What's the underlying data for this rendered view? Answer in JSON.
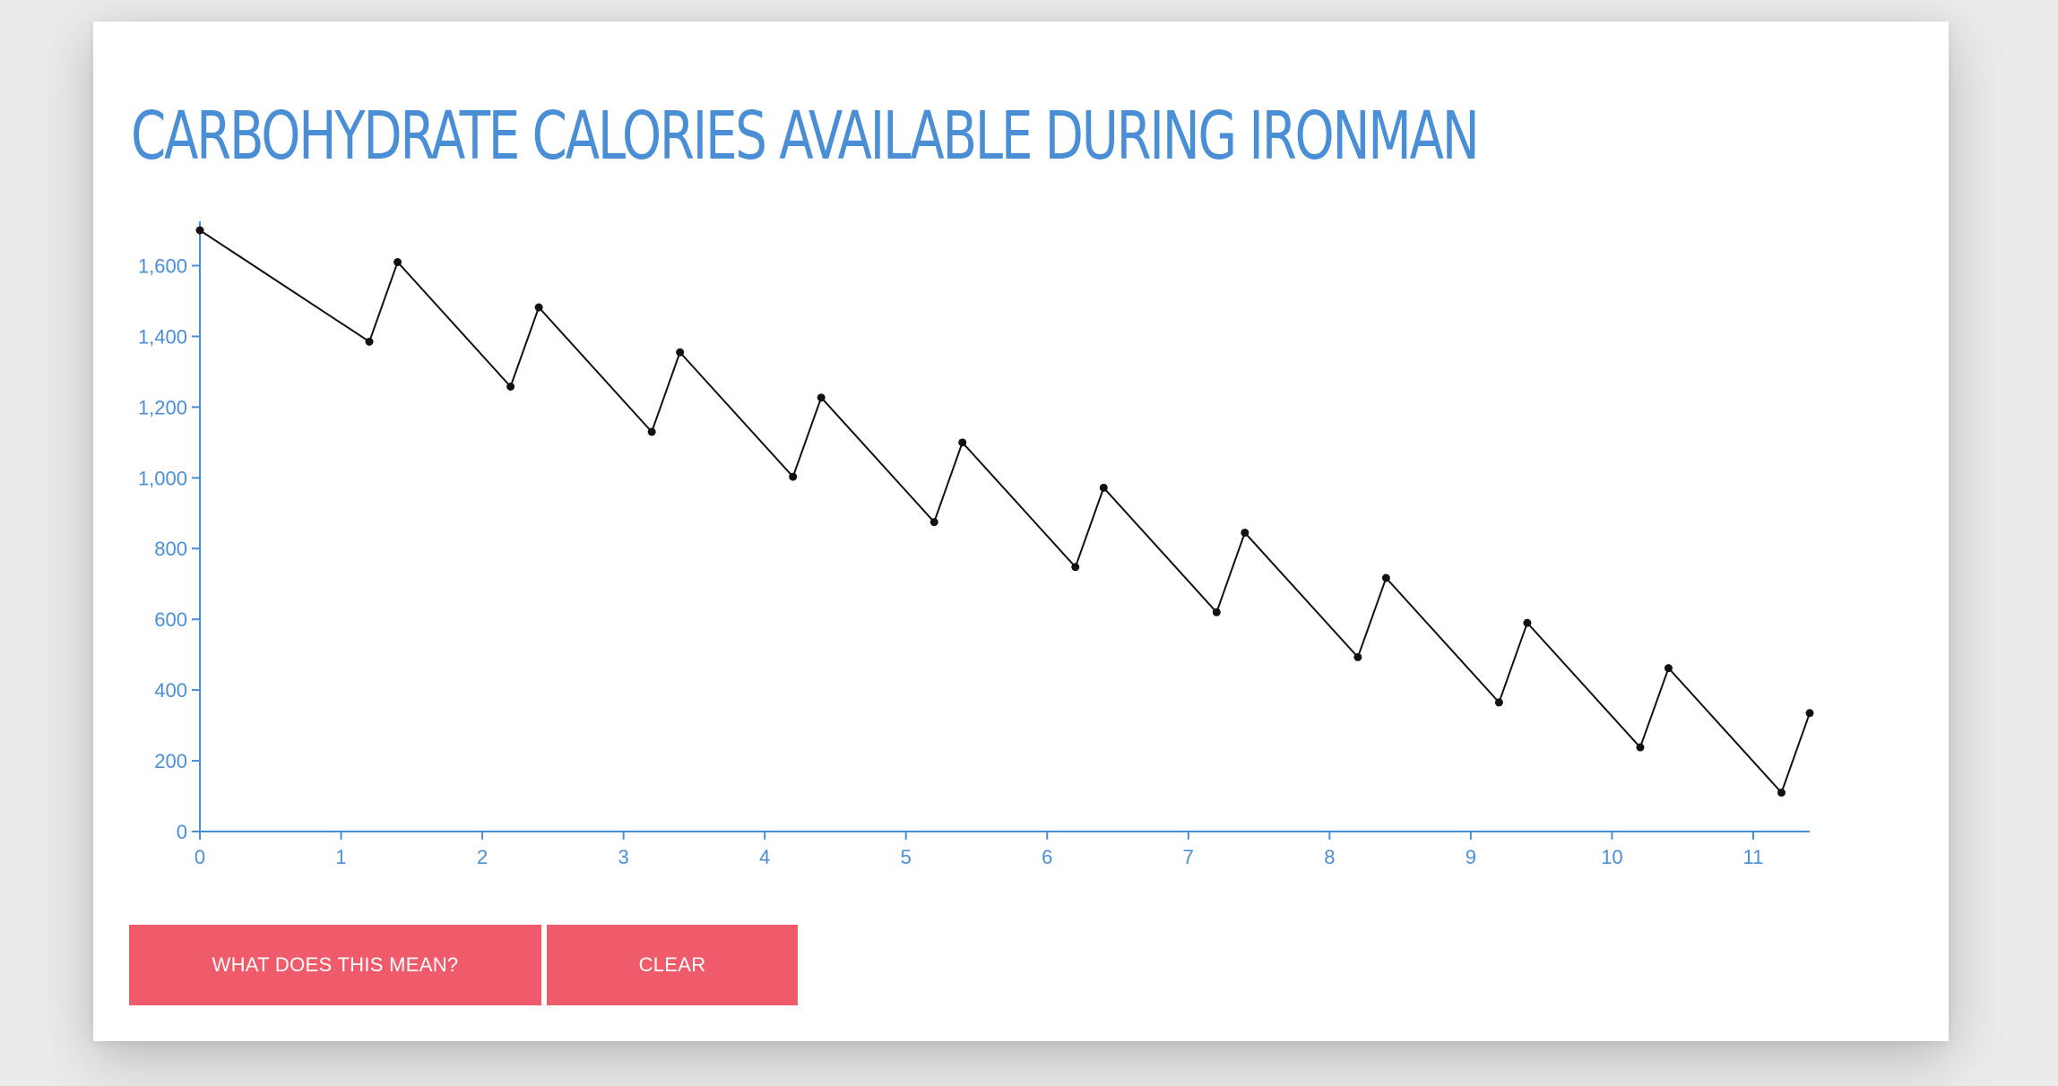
{
  "page": {
    "title": "CARBOHYDRATE CALORIES AVAILABLE DURING IRONMAN"
  },
  "buttons": {
    "meaning_label": "WHAT DOES THIS MEAN?",
    "clear_label": "CLEAR"
  },
  "colors": {
    "accent": "#4a8ed6",
    "line": "#111111",
    "button": "#ef5b6b",
    "background": "#ffffff"
  },
  "chart_data": {
    "type": "line",
    "title": "CARBOHYDRATE CALORIES AVAILABLE DURING IRONMAN",
    "xlabel": "",
    "ylabel": "",
    "xlim": [
      0,
      11.4
    ],
    "ylim": [
      0,
      1700
    ],
    "x_ticks": [
      0,
      1,
      2,
      3,
      4,
      5,
      6,
      7,
      8,
      9,
      10,
      11
    ],
    "y_ticks": [
      0,
      200,
      400,
      600,
      800,
      1000,
      1200,
      1400,
      1600
    ],
    "y_tick_labels": [
      "0",
      "200",
      "400",
      "600",
      "800",
      "1,000",
      "1,200",
      "1,400",
      "1,600"
    ],
    "grid": false,
    "series": [
      {
        "x": [
          0,
          1.2,
          1.4,
          2.2,
          2.4,
          3.2,
          3.4,
          4.2,
          4.4,
          5.2,
          5.4,
          6.2,
          6.4,
          7.2,
          7.4,
          8.2,
          8.4,
          9.2,
          9.4,
          10.2,
          10.4,
          11.2,
          11.4
        ],
        "y": [
          1700,
          1385,
          1610,
          1258,
          1482,
          1130,
          1355,
          1003,
          1227,
          875,
          1100,
          748,
          972,
          620,
          845,
          493,
          717,
          365,
          590,
          238,
          462,
          110,
          335
        ]
      }
    ]
  }
}
